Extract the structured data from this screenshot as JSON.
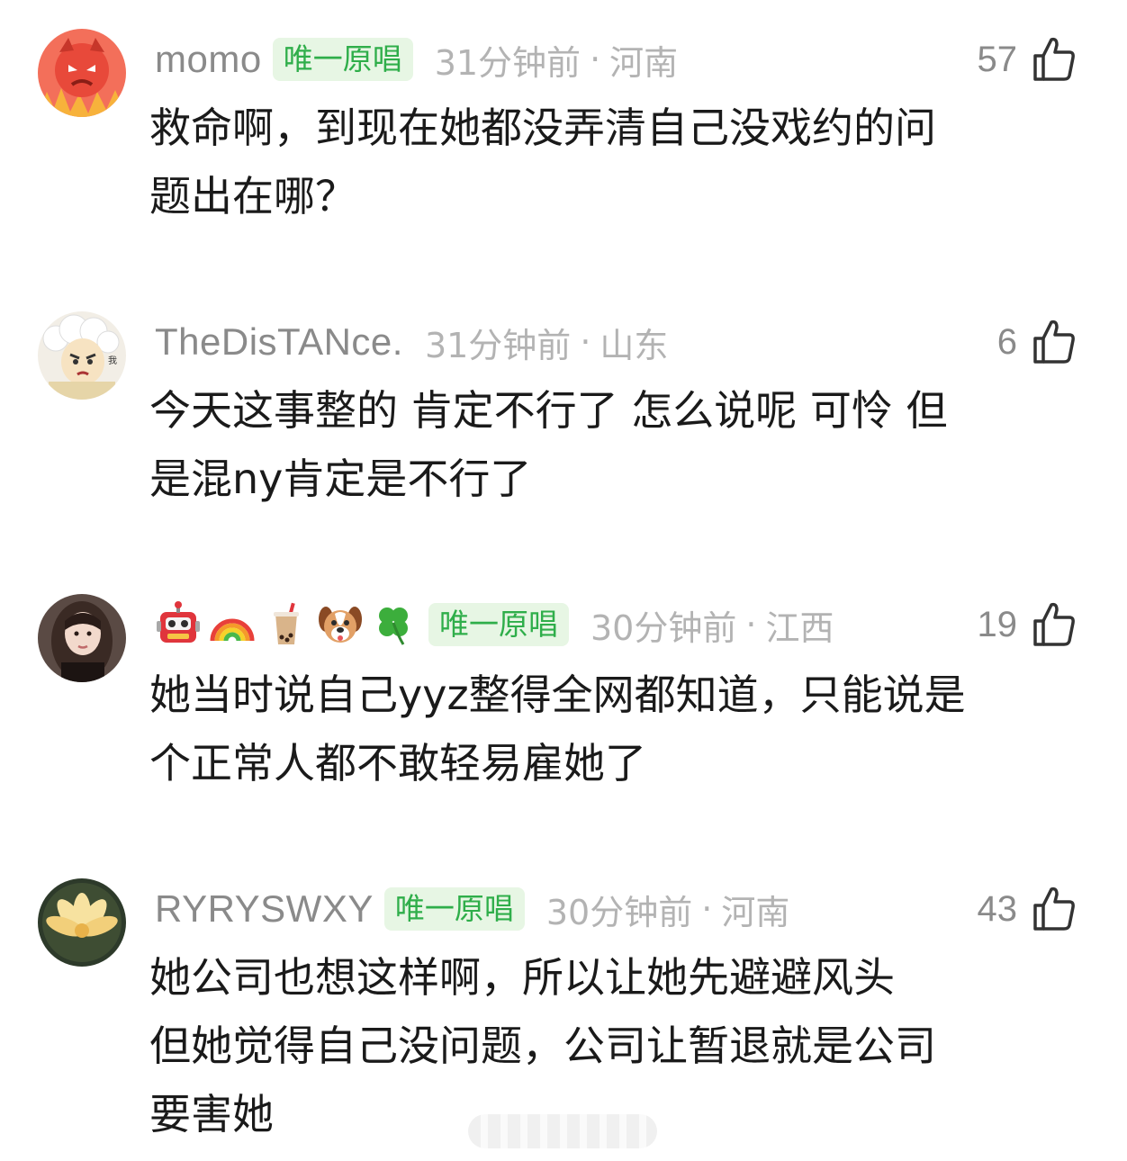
{
  "comments": [
    {
      "avatar": "red-demon-avatar",
      "username": "momo",
      "badge": "唯一原唱",
      "time": "31分钟前",
      "region": "河南",
      "likes": "57",
      "text": "救命啊，到现在她都没弄清自己没戏约的问\n题出在哪？"
    },
    {
      "avatar": "angry-sheep-avatar",
      "username": "TheDisTANce.",
      "badge": "",
      "time": "31分钟前",
      "region": "山东",
      "likes": "6",
      "text": "今天这事整的 肯定不行了 怎么说呢 可怜 但\n是混ny肯定是不行了"
    },
    {
      "avatar": "girl-photo-avatar",
      "username_emojis": [
        "robot-emoji",
        "rainbow-emoji",
        "bubble-tea-emoji",
        "dog-face-emoji",
        "four-leaf-clover-emoji"
      ],
      "badge": "唯一原唱",
      "time": "30分钟前",
      "region": "江西",
      "likes": "19",
      "text": "她当时说自己yyz整得全网都知道，只能说是\n个正常人都不敢轻易雇她了"
    },
    {
      "avatar": "lotus-avatar",
      "username": "RYRYSWXY",
      "badge": "唯一原唱",
      "time": "30分钟前",
      "region": "河南",
      "likes": "43",
      "text": "她公司也想这样啊，所以让她先避避风头\n但她觉得自己没问题，公司让暂退就是公司\n要害她"
    }
  ],
  "separator": "·",
  "icons": {
    "like": "thumbs-up-icon"
  },
  "colors": {
    "badge_bg": "#e7f6e4",
    "badge_text": "#2fae4a",
    "meta_text": "#b3b3b3",
    "username": "#8a8a8a",
    "body_text": "#1a1a1a"
  }
}
